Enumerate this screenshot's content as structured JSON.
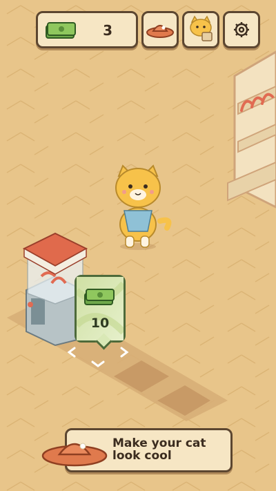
{
  "hud": {
    "money_icon": "cash-stack-icon",
    "money_count": "3",
    "hat_icon": "red-hat-icon",
    "cat_icon": "cat-portrait-icon",
    "settings_icon": "gear-icon"
  },
  "station": {
    "price_icon": "cash-stack-icon",
    "price_value": "10"
  },
  "tip": {
    "icon": "red-hat-icon",
    "text_line1": "Make your cat",
    "text_line2": "look cool"
  },
  "colors": {
    "ground": "#e8c58a",
    "panel": "#f6e6c4",
    "outline": "#5c4630",
    "price_card": "#d9e8b6",
    "hat": "#e07a4d",
    "cat": "#f7c24a"
  }
}
